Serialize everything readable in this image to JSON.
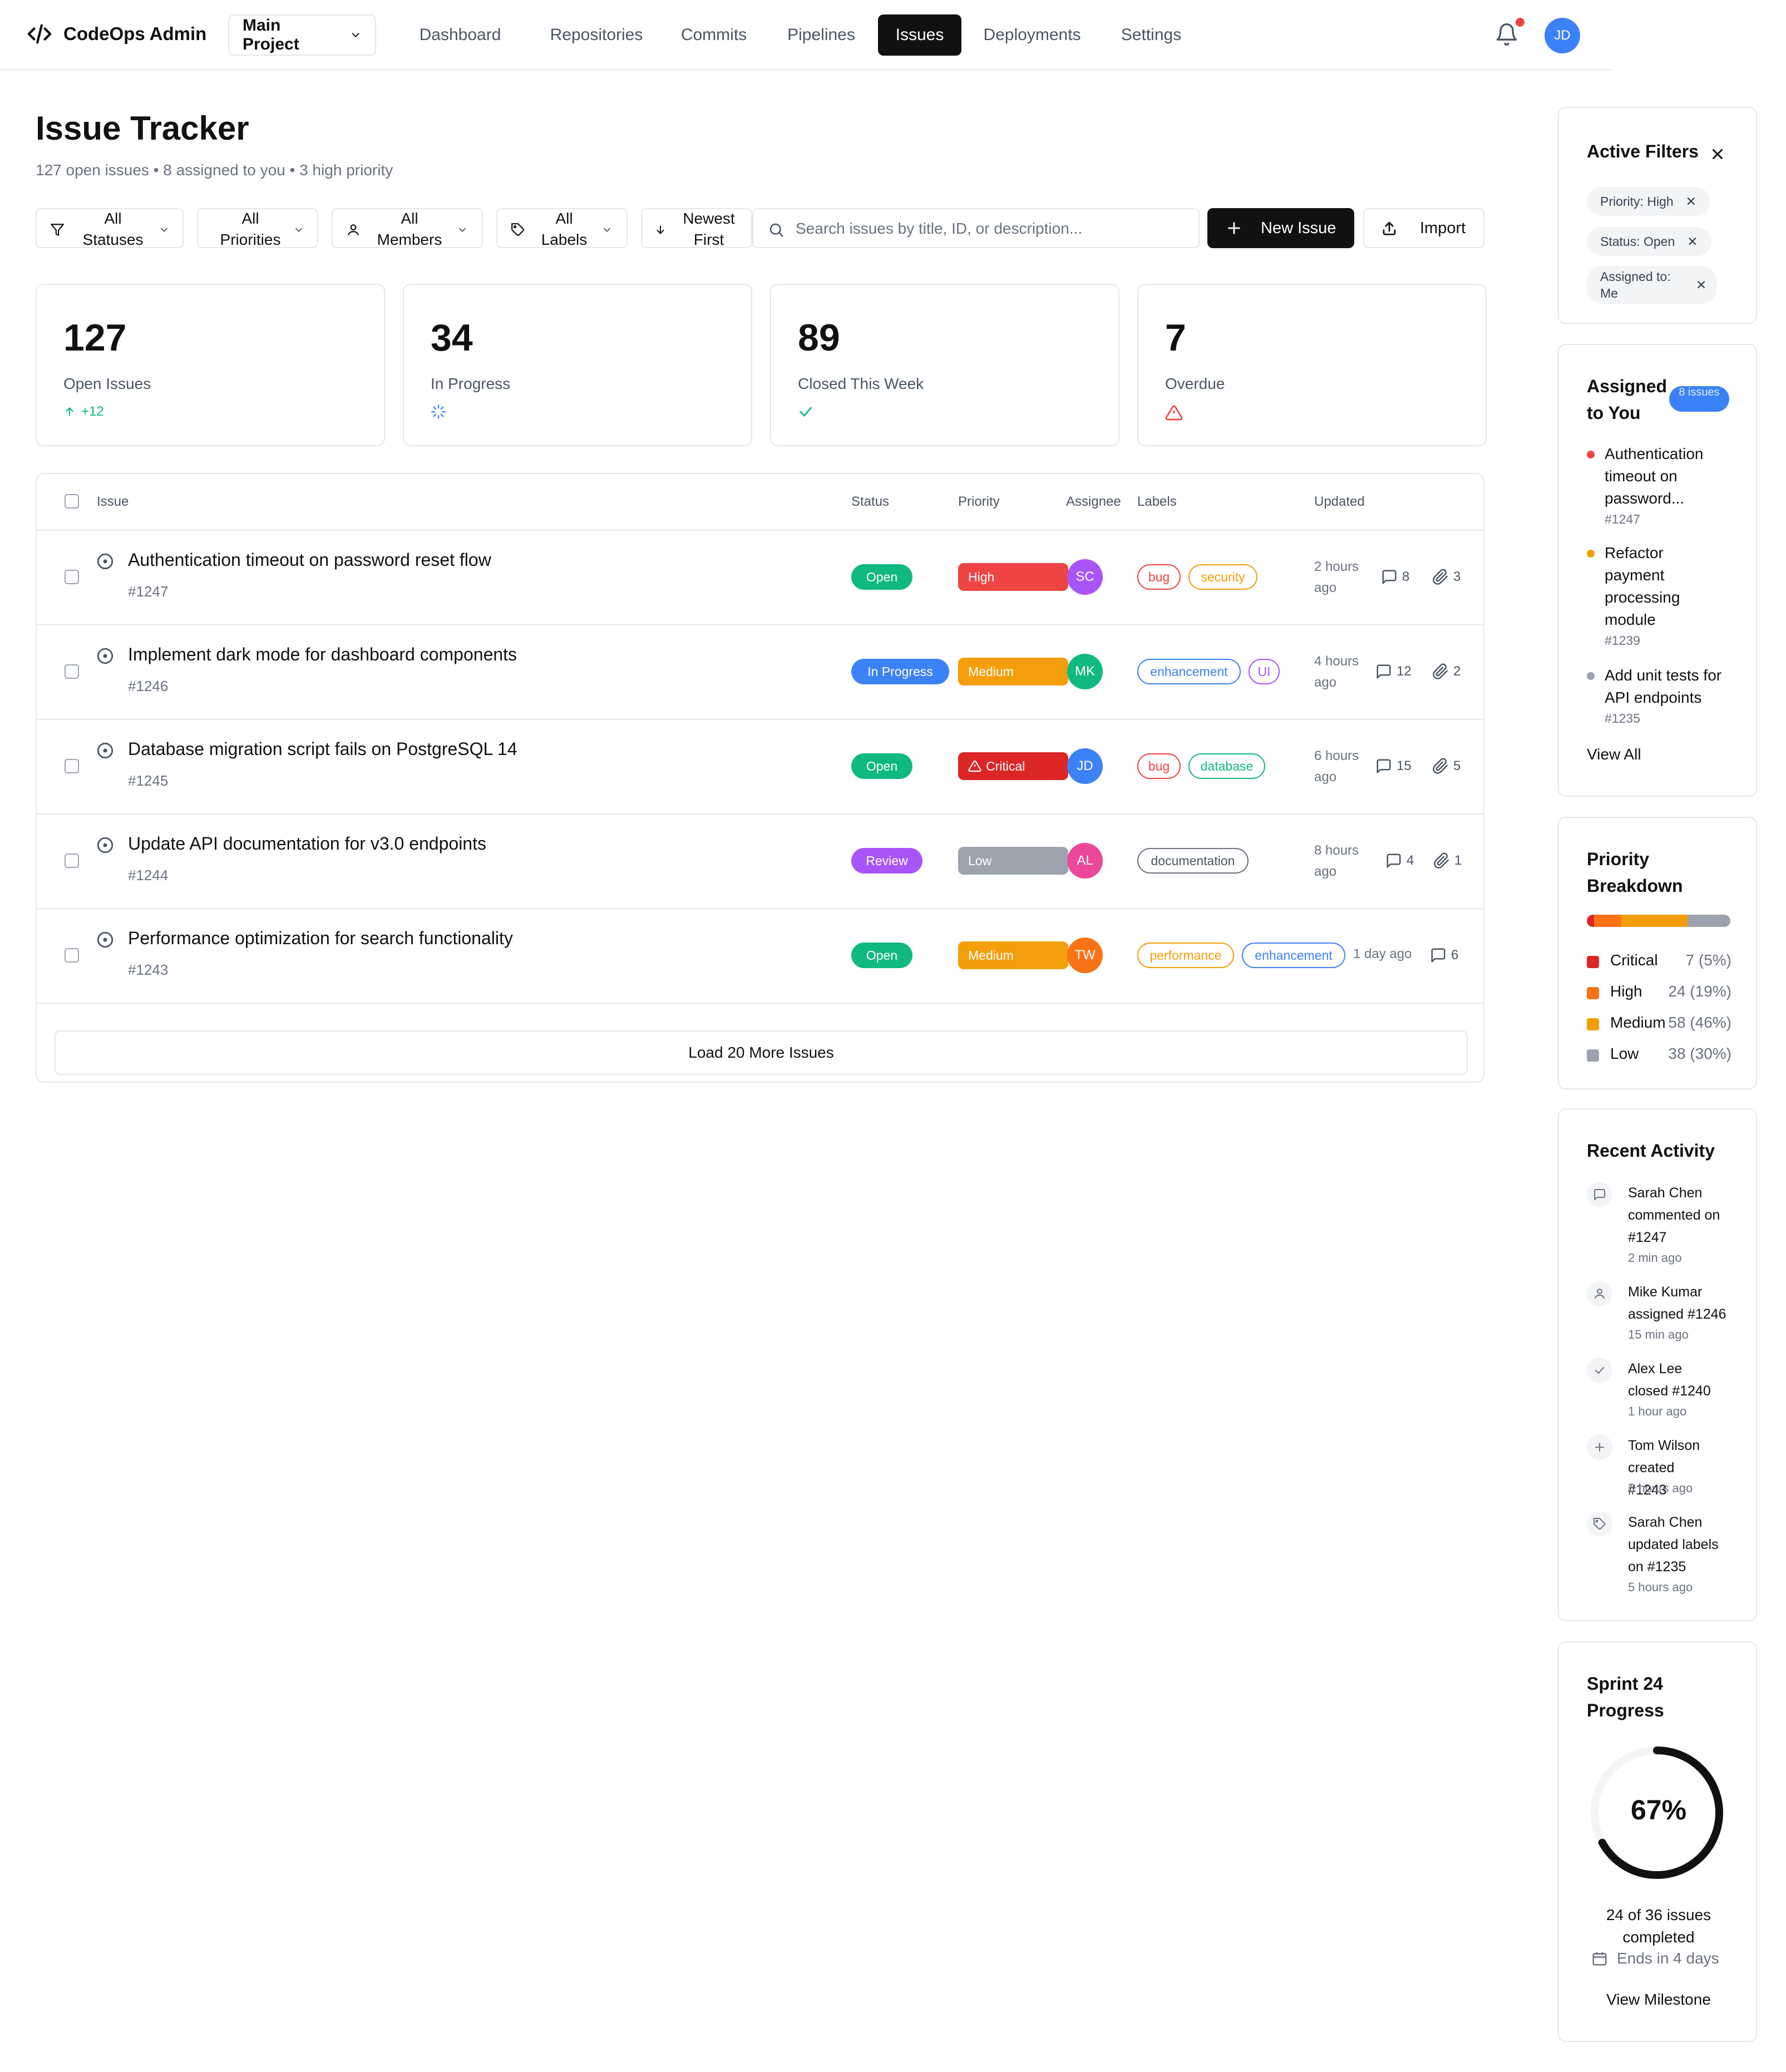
{
  "app": {
    "title": "CodeOps Admin",
    "project": "Main Project"
  },
  "nav": {
    "tabs": [
      {
        "label": "Dashboard"
      },
      {
        "label": "Repositories"
      },
      {
        "label": "Commits"
      },
      {
        "label": "Pipelines"
      },
      {
        "label": "Issues",
        "active": true
      },
      {
        "label": "Deployments"
      },
      {
        "label": "Settings"
      }
    ],
    "avatar": "JD"
  },
  "header": {
    "title": "Issue Tracker",
    "subtitle": "127 open issues • 8 assigned to you • 3 high priority"
  },
  "filters": {
    "status": "All Statuses",
    "priority": "All Priorities",
    "members": "All Members",
    "labels": "All Labels",
    "sort": "Newest First",
    "search_placeholder": "Search issues by title, ID, or description...",
    "new_issue": "New Issue",
    "import": "Import"
  },
  "stats": [
    {
      "value": "127",
      "label": "Open Issues",
      "delta": "+12"
    },
    {
      "value": "34",
      "label": "In Progress"
    },
    {
      "value": "89",
      "label": "Closed This Week"
    },
    {
      "value": "7",
      "label": "Overdue"
    }
  ],
  "table": {
    "headers": {
      "issue": "Issue",
      "status": "Status",
      "priority": "Priority",
      "assignee": "Assignee",
      "labels": "Labels",
      "updated": "Updated"
    },
    "rows": [
      {
        "title": "Authentication timeout on password reset flow",
        "id": "#1247",
        "status": "Open",
        "priority": "High",
        "assignee": "SC",
        "labels": [
          "bug",
          "security"
        ],
        "updated": "2 hours ago",
        "comments": "8",
        "attachments": "3"
      },
      {
        "title": "Implement dark mode for dashboard components",
        "id": "#1246",
        "status": "In Progress",
        "priority": "Medium",
        "assignee": "MK",
        "labels": [
          "enhancement",
          "UI"
        ],
        "updated": "4 hours ago",
        "comments": "12",
        "attachments": "2"
      },
      {
        "title": "Database migration script fails on PostgreSQL 14",
        "id": "#1245",
        "status": "Open",
        "priority": "Critical",
        "assignee": "JD",
        "labels": [
          "bug",
          "database"
        ],
        "updated": "6 hours ago",
        "comments": "15",
        "attachments": "5"
      },
      {
        "title": "Update API documentation for v3.0 endpoints",
        "id": "#1244",
        "status": "Review",
        "priority": "Low",
        "assignee": "AL",
        "labels": [
          "documentation"
        ],
        "updated": "8 hours ago",
        "comments": "4",
        "attachments": "1"
      },
      {
        "title": "Performance optimization for search functionality",
        "id": "#1243",
        "status": "Open",
        "priority": "Medium",
        "assignee": "TW",
        "labels": [
          "performance",
          "enhancement"
        ],
        "updated": "1 day ago",
        "comments": "6"
      }
    ],
    "load_more": "Load 20 More Issues"
  },
  "sidebar": {
    "active_filters": {
      "title": "Active Filters",
      "chips": [
        "Priority: High",
        "Status: Open",
        "Assigned to: Me"
      ]
    },
    "assigned": {
      "title": "Assigned to You",
      "badge": "8 issues",
      "items": [
        {
          "title": "Authentication timeout on password...",
          "id": "#1247"
        },
        {
          "title": "Refactor payment processing module",
          "id": "#1239"
        },
        {
          "title": "Add unit tests for API endpoints",
          "id": "#1235"
        }
      ],
      "view_all": "View All"
    },
    "priority": {
      "title": "Priority Breakdown",
      "items": [
        {
          "name": "Critical",
          "value": "7 (5%)",
          "percent": 5,
          "color": "#dc2626"
        },
        {
          "name": "High",
          "value": "24 (19%)",
          "percent": 19,
          "color": "#f97316"
        },
        {
          "name": "Medium",
          "value": "58 (46%)",
          "percent": 46,
          "color": "#f59e0b"
        },
        {
          "name": "Low",
          "value": "38 (30%)",
          "percent": 30,
          "color": "#9ca3af"
        }
      ]
    },
    "activity": {
      "title": "Recent Activity",
      "items": [
        {
          "icon": "comment-icon",
          "text": "Sarah Chen commented on #1247",
          "time": "2 min ago"
        },
        {
          "icon": "user-icon",
          "text": "Mike Kumar assigned #1246",
          "time": "15 min ago"
        },
        {
          "icon": "check-icon",
          "text": "Alex Lee closed #1240",
          "time": "1 hour ago"
        },
        {
          "icon": "plus-icon",
          "text": "Tom Wilson created #1243",
          "time": "3 hours ago"
        },
        {
          "icon": "tag-icon",
          "text": "Sarah Chen updated labels on #1235",
          "time": "5 hours ago"
        }
      ]
    },
    "sprint": {
      "title": "Sprint 24 Progress",
      "percent_label": "67%",
      "progress": 0.67,
      "summary": "24 of 36 issues completed",
      "ends": "Ends in 4 days",
      "view_milestone": "View Milestone"
    }
  },
  "colors": {
    "accent": "#111111",
    "open": "#10b981",
    "in_progress": "#3b82f6",
    "review": "#a855f7",
    "high": "#ef4444",
    "critical": "#dc2626",
    "medium": "#f59e0b",
    "low": "#9ca3af"
  }
}
